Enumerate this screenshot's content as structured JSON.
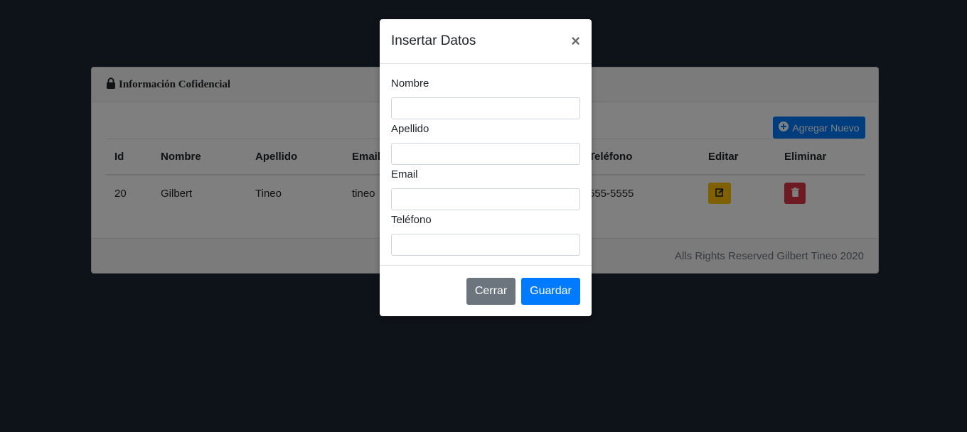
{
  "card": {
    "title": "Información Cofidencial",
    "add_button_label": "Agregar Nuevo",
    "footer_text": "Alls Rights Reserved Gilbert Tineo 2020"
  },
  "table": {
    "headers": [
      "Id",
      "Nombre",
      "Apellido",
      "Email",
      "Teléfono",
      "Editar",
      "Eliminar"
    ],
    "rows": [
      {
        "id": "20",
        "nombre": "Gilbert",
        "apellido": "Tineo",
        "email": "tineo",
        "telefono": "555-5555"
      }
    ]
  },
  "modal": {
    "title": "Insertar Datos",
    "close_symbol": "×",
    "fields": [
      {
        "label": "Nombre",
        "value": ""
      },
      {
        "label": "Apellido",
        "value": ""
      },
      {
        "label": "Email",
        "value": ""
      },
      {
        "label": "Teléfono",
        "value": ""
      }
    ],
    "cancel_label": "Cerrar",
    "save_label": "Guardar"
  },
  "colors": {
    "page_background": "#1c2532",
    "primary": "#007bff",
    "secondary": "#6c757d",
    "warning": "#ffc107",
    "danger": "#dc3545"
  },
  "icons": [
    "lock-icon",
    "plus-circle-icon",
    "edit-icon",
    "trash-icon",
    "close-icon"
  ]
}
